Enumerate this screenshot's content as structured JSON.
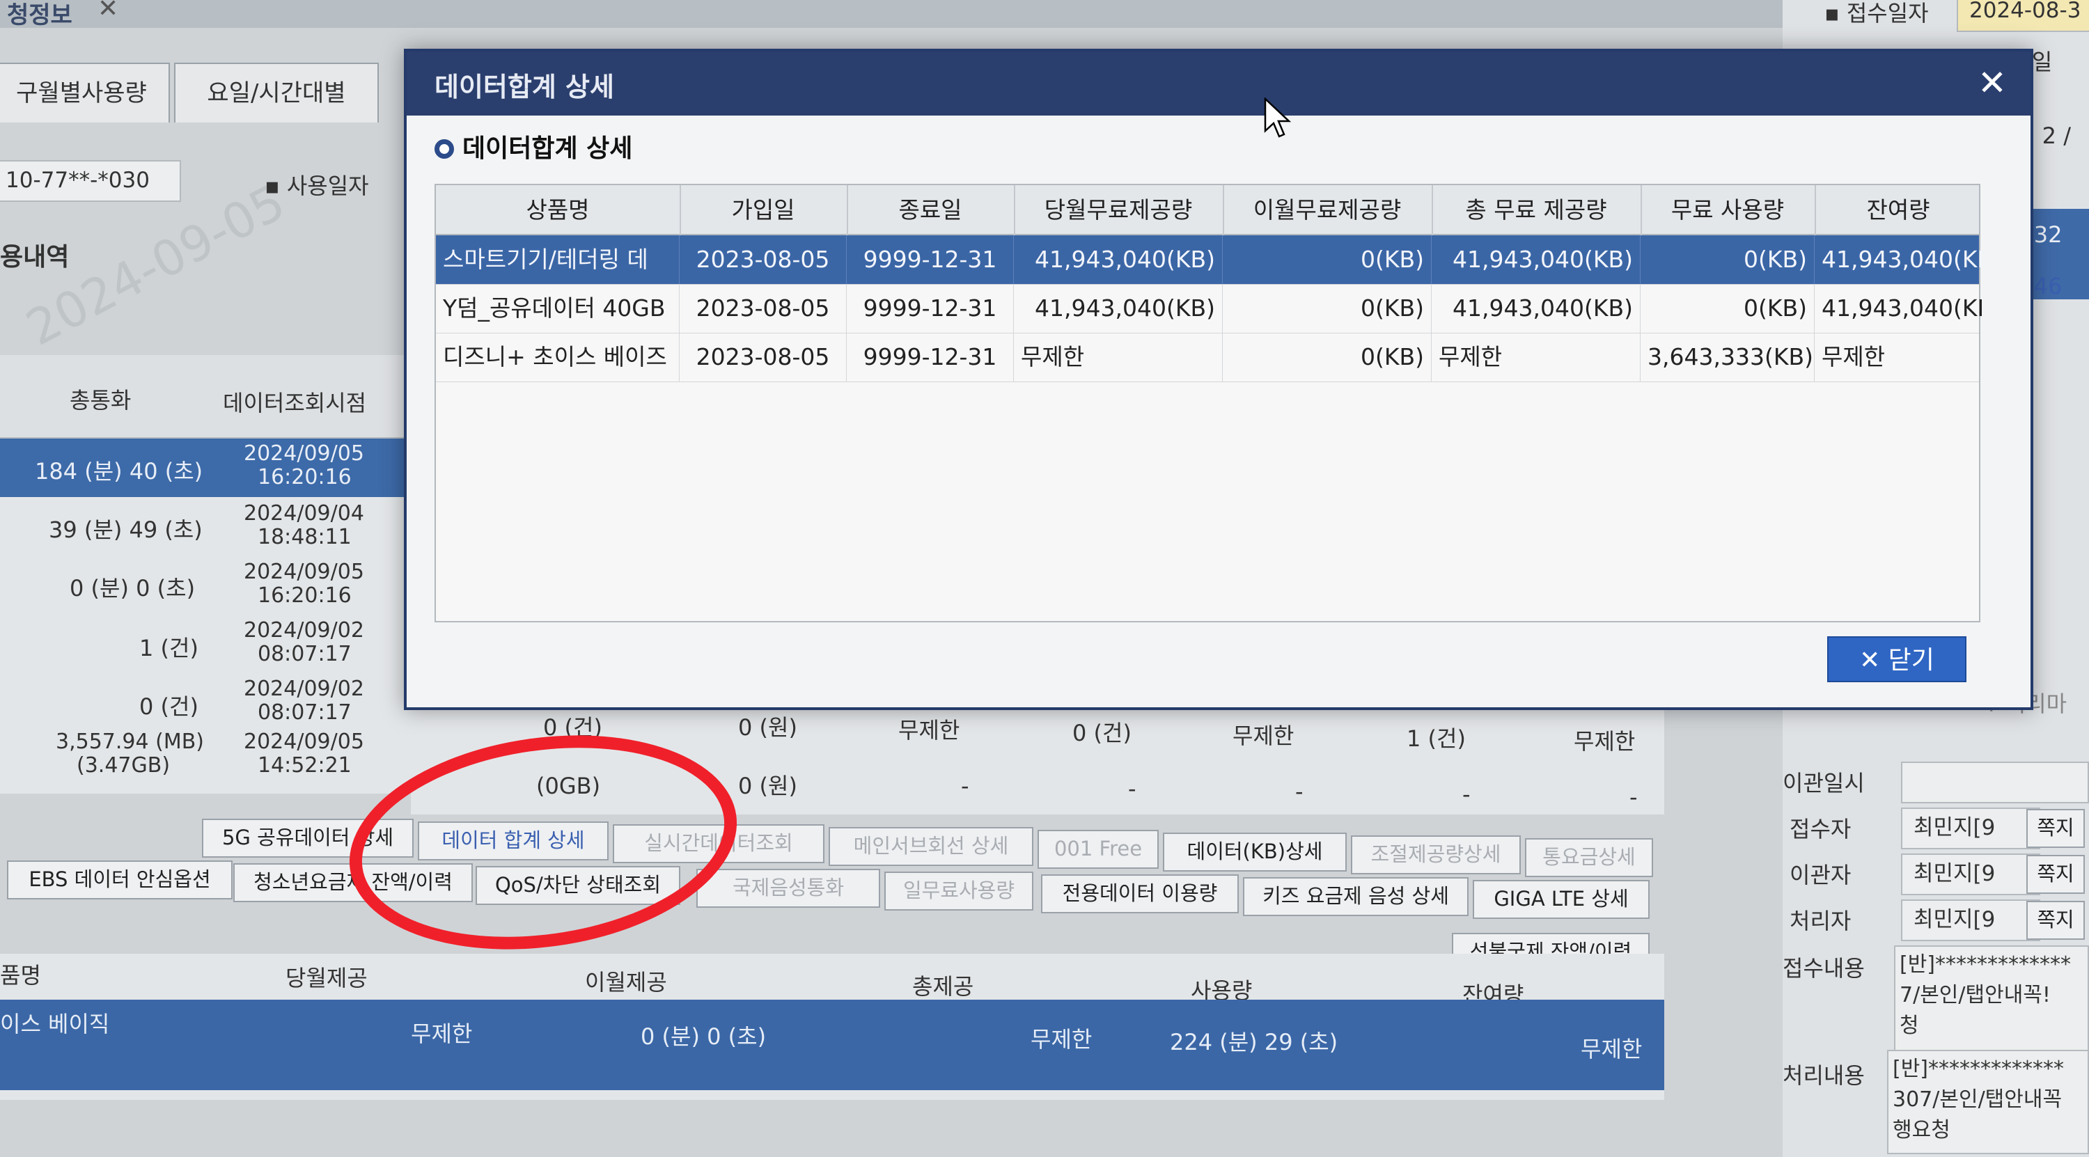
{
  "background": {
    "window_tab_title": "청정보",
    "tabs": [
      "구월별사용량",
      "요일/시간대별"
    ],
    "id_field": "10-77**-*030",
    "date_label": "사용일자",
    "section_title": "용내역",
    "watermark_date": "2024-09-05",
    "left_table": {
      "headers": [
        "총통화",
        "데이터조회시점"
      ],
      "rows": [
        {
          "total": "184 (분) 40 (초)",
          "time1": "2024/09/05",
          "time2": "16:20:16",
          "selected": true
        },
        {
          "total": "39 (분) 49 (초)",
          "time1": "2024/09/04",
          "time2": "18:48:11"
        },
        {
          "total": "0 (분) 0 (초)",
          "time1": "2024/09/05",
          "time2": "16:20:16"
        },
        {
          "total": "1 (건)",
          "time1": "2024/09/02",
          "time2": "08:07:17"
        },
        {
          "total": "0 (건)",
          "time1": "2024/09/02",
          "time2": "08:07:17"
        },
        {
          "total": "3,557.94 (MB)",
          "total2": "(3.47GB)",
          "time1": "2024/09/05",
          "time2": "14:52:21"
        }
      ]
    },
    "mid_rows": [
      [
        "0 (건)",
        "0 (원)",
        "무제한",
        "0 (건)",
        "무제한",
        "1 (건)",
        "무제한"
      ],
      [
        "(0GB)",
        "0 (원)",
        "-",
        "-",
        "-",
        "-",
        "-"
      ]
    ],
    "buttons_row1": [
      "5G 공유데이터 상세",
      "데이터 합계 상세",
      "실시간데이터조회",
      "메인서브회선 상세",
      "001 Free",
      "데이터(KB)상세",
      "조절제공량상세",
      "통요금상세"
    ],
    "buttons_row2": [
      "EBS 데이터 안심옵션",
      "청소년요금제 잔액/이력",
      "QoS/차단 상태조회",
      "국제음성통화",
      "일무료사용량",
      "전용데이터 이용량",
      "키즈 요금제 음성 상세",
      "GIGA LTE 상세"
    ],
    "button_row3": "선불국제 잔액/이력",
    "bottom_table": {
      "headers": [
        "품명",
        "당월제공",
        "이월제공",
        "총제공",
        "사용량",
        "잔여량"
      ],
      "row": [
        "이스 베이직",
        "무제한",
        "0 (분) 0 (초)",
        "무제한",
        "224 (분) 29 (초)",
        "무제한"
      ]
    },
    "right_panel": {
      "receipt_label": "접수일자",
      "receipt_value": "2024-08-3",
      "radio1": "당일",
      "radio2": "1주일",
      "page": "[ 2 /",
      "times": [
        ":32",
        ":46"
      ],
      "side_note": "T 처리마",
      "fields": [
        {
          "label": "이관일시",
          "value": ""
        },
        {
          "label": "접수자",
          "value": "최민지[9",
          "btn": "쪽지"
        },
        {
          "label": "이관자",
          "value": "최민지[9",
          "btn": "쪽지"
        },
        {
          "label": "처리자",
          "value": "최민지[9",
          "btn": "쪽지"
        }
      ],
      "content_label": "접수내용",
      "content_lines": [
        "[반]*************",
        "7/본인/탭안내꼭!",
        "청"
      ],
      "process_label": "처리내용",
      "process_lines": [
        "[반]*************",
        "307/본인/탭안내꼭",
        "행요청"
      ]
    }
  },
  "modal": {
    "title": "데이터합계 상세",
    "section_title": "데이터합계 상세",
    "close_label": "닫기",
    "close_icon": "close-icon",
    "columns": [
      "상품명",
      "가입일",
      "종료일",
      "당월무료제공량",
      "이월무료제공량",
      "총 무료 제공량",
      "무료 사용량",
      "잔여량"
    ],
    "rows": [
      {
        "cells": [
          "스마트기기/테더링 데",
          "2023-08-05",
          "9999-12-31",
          "41,943,040(KB)",
          "0(KB)",
          "41,943,040(KB)",
          "0(KB)",
          "41,943,040(KE"
        ],
        "selected": true
      },
      {
        "cells": [
          "Y덤_공유데이터 40GB",
          "2023-08-05",
          "9999-12-31",
          "41,943,040(KB)",
          "0(KB)",
          "41,943,040(KB)",
          "0(KB)",
          "41,943,040(KE"
        ]
      },
      {
        "cells": [
          "디즈니+ 초이스 베이즈",
          "2023-08-05",
          "9999-12-31",
          "무제한",
          "0(KB)",
          "무제한",
          "3,643,333(KB)",
          "무제한"
        ]
      }
    ]
  }
}
